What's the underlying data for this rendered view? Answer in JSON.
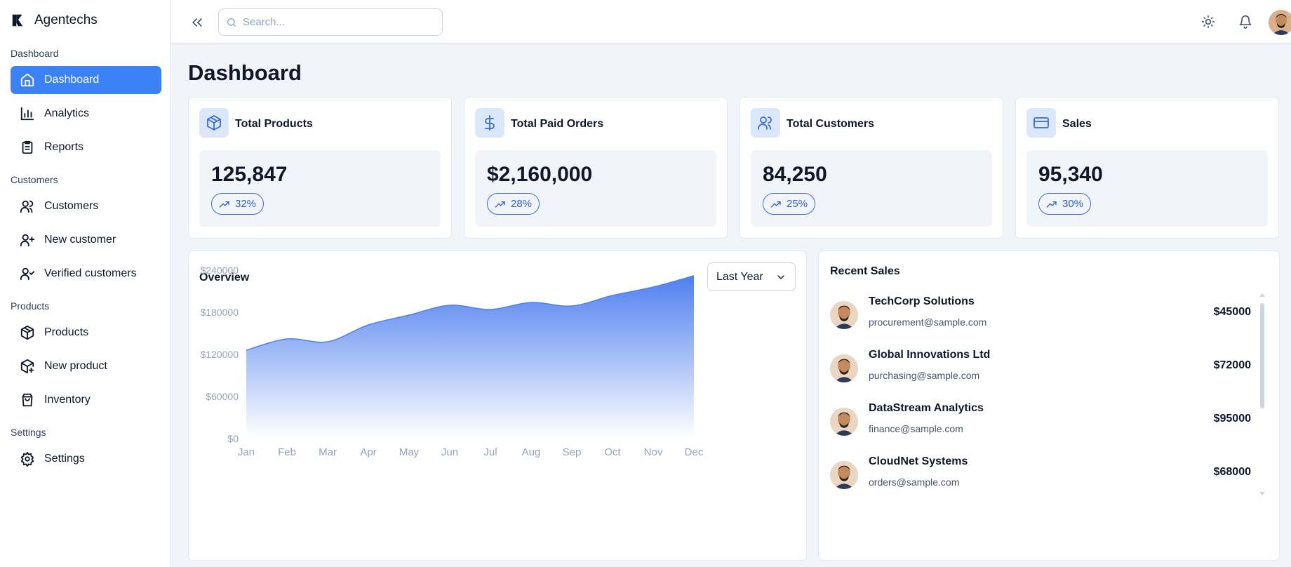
{
  "brand": {
    "name": "Agentechs"
  },
  "sidebar": {
    "sections": [
      {
        "title": "Dashboard",
        "items": [
          {
            "label": "Dashboard",
            "icon": "home-icon",
            "active": true
          },
          {
            "label": "Analytics",
            "icon": "bar-chart-icon"
          },
          {
            "label": "Reports",
            "icon": "clipboard-icon"
          }
        ]
      },
      {
        "title": "Customers",
        "items": [
          {
            "label": "Customers",
            "icon": "users-icon"
          },
          {
            "label": "New customer",
            "icon": "user-plus-icon"
          },
          {
            "label": "Verified customers",
            "icon": "user-check-icon"
          }
        ]
      },
      {
        "title": "Products",
        "items": [
          {
            "label": "Products",
            "icon": "package-icon"
          },
          {
            "label": "New product",
            "icon": "package-plus-icon"
          },
          {
            "label": "Inventory",
            "icon": "shopping-bag-icon"
          }
        ]
      },
      {
        "title": "Settings",
        "items": [
          {
            "label": "Settings",
            "icon": "gear-icon"
          }
        ]
      }
    ]
  },
  "topbar": {
    "search_placeholder": "Search..."
  },
  "page": {
    "title": "Dashboard"
  },
  "stats": [
    {
      "title": "Total Products",
      "value": "125,847",
      "trend": "32%",
      "icon": "box-icon"
    },
    {
      "title": "Total Paid Orders",
      "value": "$2,160,000",
      "trend": "28%",
      "icon": "dollar-icon"
    },
    {
      "title": "Total Customers",
      "value": "84,250",
      "trend": "25%",
      "icon": "users-icon"
    },
    {
      "title": "Sales",
      "value": "95,340",
      "trend": "30%",
      "icon": "credit-card-icon"
    }
  ],
  "overview": {
    "title": "Overview",
    "period": "Last Year"
  },
  "chart_data": {
    "type": "area",
    "categories": [
      "Jan",
      "Feb",
      "Mar",
      "Apr",
      "May",
      "Jun",
      "Jul",
      "Aug",
      "Sep",
      "Oct",
      "Nov",
      "Dec"
    ],
    "values": [
      126000,
      142000,
      138000,
      162000,
      176000,
      190000,
      184000,
      194000,
      189000,
      204000,
      216000,
      232000
    ],
    "ylim": [
      0,
      240000
    ],
    "y_ticks": [
      "$0",
      "$60000",
      "$120000",
      "$180000",
      "$240000"
    ],
    "grid": false,
    "color": "#4f7fef"
  },
  "recent_sales": {
    "title": "Recent Sales",
    "items": [
      {
        "name": "TechCorp Solutions",
        "email": "procurement@sample.com",
        "amount": "$45000"
      },
      {
        "name": "Global Innovations Ltd",
        "email": "purchasing@sample.com",
        "amount": "$72000"
      },
      {
        "name": "DataStream Analytics",
        "email": "finance@sample.com",
        "amount": "$95000"
      },
      {
        "name": "CloudNet Systems",
        "email": "orders@sample.com",
        "amount": "$68000"
      }
    ]
  }
}
